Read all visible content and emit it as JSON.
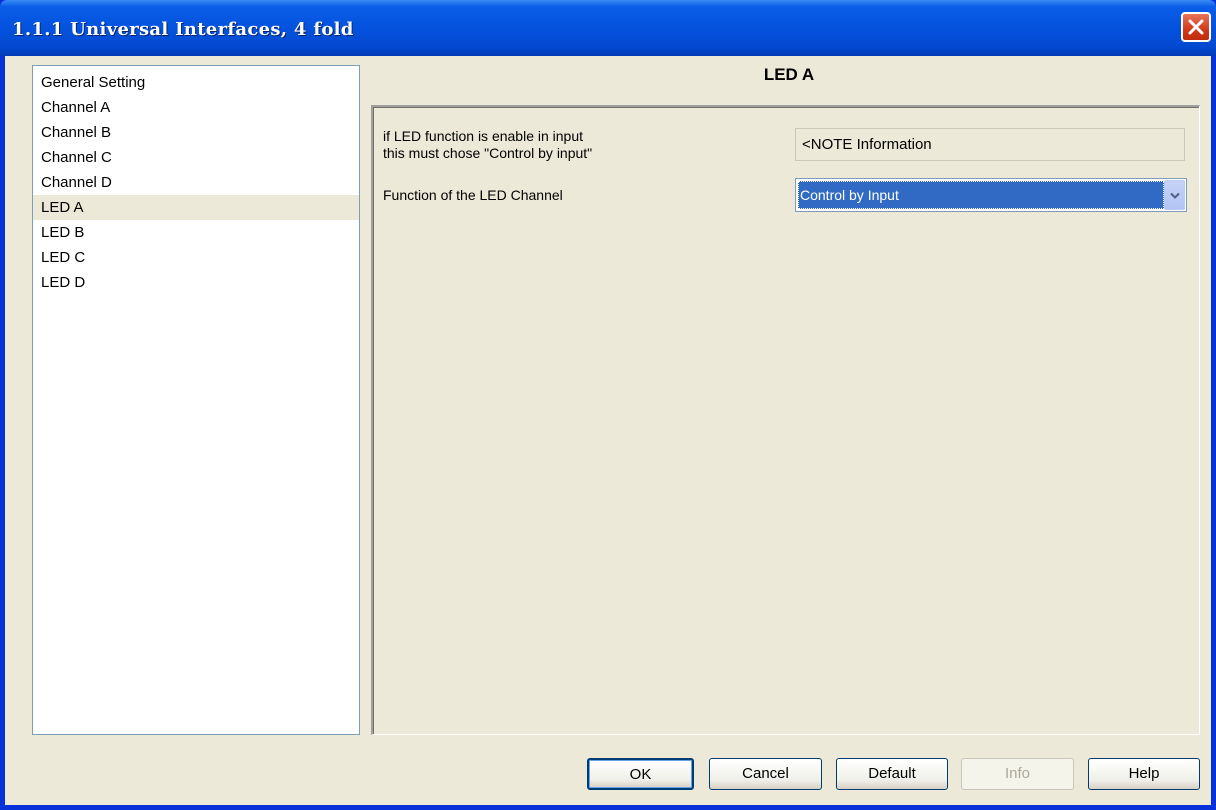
{
  "window": {
    "title": "1.1.1 Universal Interfaces, 4 fold"
  },
  "sidebar": {
    "items": [
      {
        "label": "General Setting"
      },
      {
        "label": "Channel A"
      },
      {
        "label": "Channel B"
      },
      {
        "label": "Channel C"
      },
      {
        "label": "Channel D"
      },
      {
        "label": "LED A"
      },
      {
        "label": "LED B"
      },
      {
        "label": "LED C"
      },
      {
        "label": "LED D"
      }
    ],
    "selected": "LED A"
  },
  "panel": {
    "title": "LED A",
    "note_label_line1": "if LED function is enable in input",
    "note_label_line2": "this must chose \"Control by input\"",
    "note_value": "<NOTE Information",
    "function_label": "Function of the LED Channel",
    "function_value": "Control by Input"
  },
  "buttons": {
    "ok": "OK",
    "cancel": "Cancel",
    "default": "Default",
    "info": "Info",
    "help": "Help"
  },
  "icons": {
    "close": "close-icon",
    "dropdown": "chevron-down-icon"
  },
  "colors": {
    "title_bar": "#0554e0",
    "close_button": "#d2391c",
    "selection": "#316ac5",
    "dialog_bg": "#ece9d8"
  }
}
